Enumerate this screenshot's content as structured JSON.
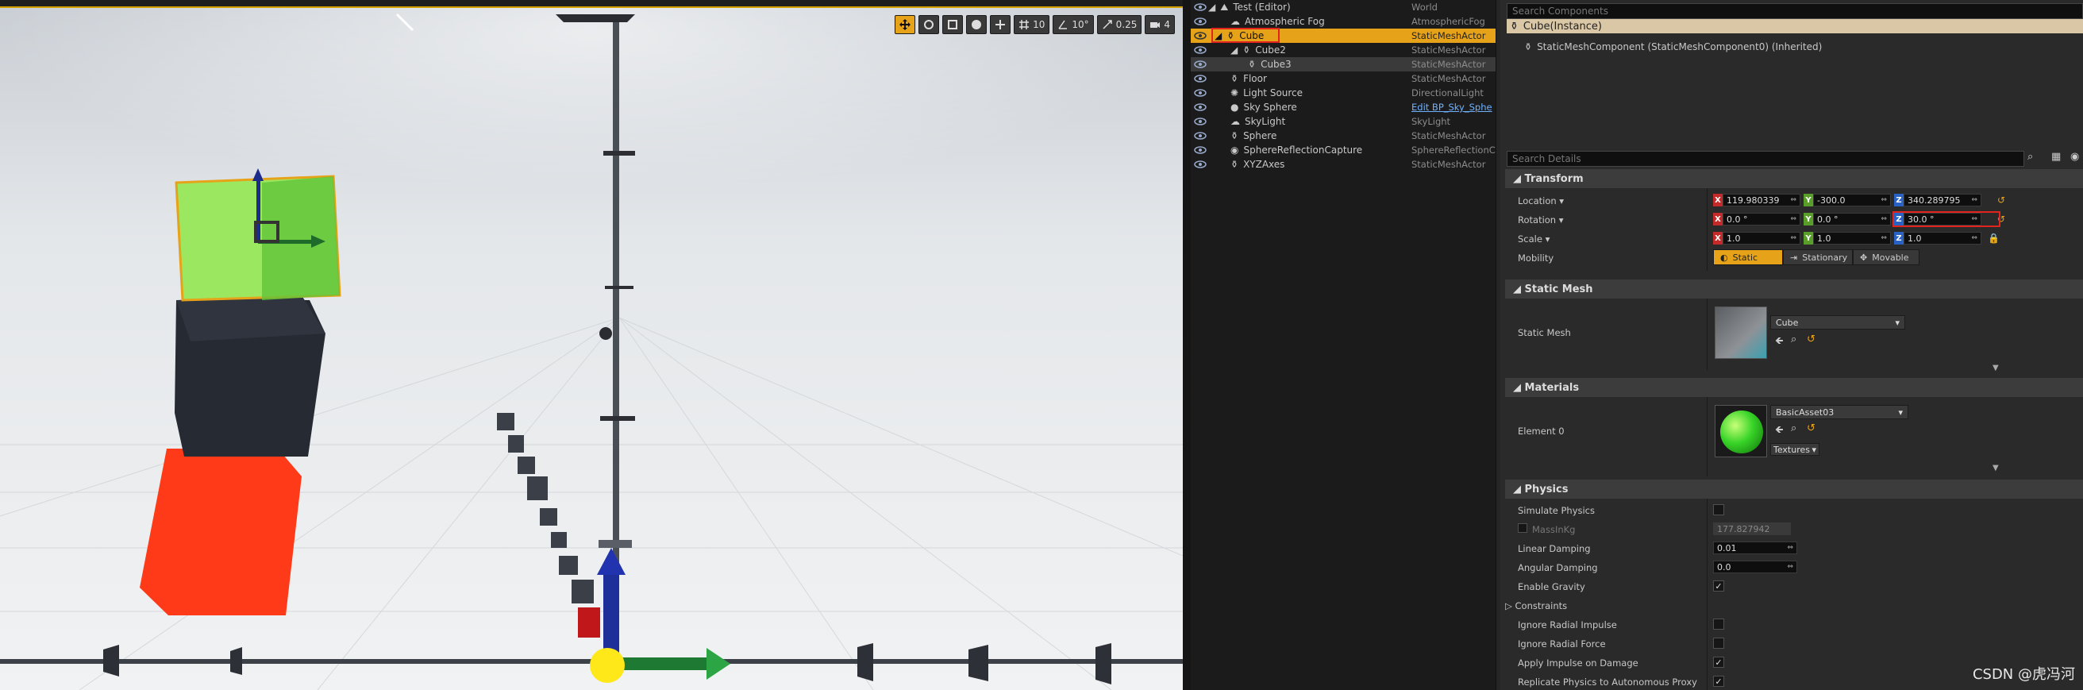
{
  "viewport": {
    "toolbar": {
      "grid_snap": "10",
      "rotation_snap": "10°",
      "scale_snap": "0.25",
      "camera_speed": "4"
    }
  },
  "outliner": {
    "rows": [
      {
        "name": "Test (Editor)",
        "type": "World"
      },
      {
        "name": "Atmospheric Fog",
        "type": "AtmosphericFog"
      },
      {
        "name": "Cube",
        "type": "StaticMeshActor"
      },
      {
        "name": "Cube2",
        "type": "StaticMeshActor"
      },
      {
        "name": "Cube3",
        "type": "StaticMeshActor"
      },
      {
        "name": "Floor",
        "type": "StaticMeshActor"
      },
      {
        "name": "Light Source",
        "type": "DirectionalLight"
      },
      {
        "name": "Sky Sphere",
        "type": "Edit BP_Sky_Sphe"
      },
      {
        "name": "SkyLight",
        "type": "SkyLight"
      },
      {
        "name": "Sphere",
        "type": "StaticMeshActor"
      },
      {
        "name": "SphereReflectionCapture",
        "type": "SphereReflectionCa"
      },
      {
        "name": "XYZAxes",
        "type": "StaticMeshActor"
      }
    ]
  },
  "details": {
    "search_components_placeholder": "Search Components",
    "component_root": "Cube(Instance)",
    "component_child": "StaticMeshComponent (StaticMeshComponent0) (Inherited)",
    "search_details_placeholder": "Search Details",
    "transform": {
      "title": "Transform",
      "location_label": "Location",
      "location": {
        "x": "119.980339",
        "y": "-300.0",
        "z": "340.289795"
      },
      "rotation_label": "Rotation",
      "rotation": {
        "x": "0.0 °",
        "y": "0.0 °",
        "z": "30.0 °"
      },
      "scale_label": "Scale",
      "scale": {
        "x": "1.0",
        "y": "1.0",
        "z": "1.0"
      },
      "mobility_label": "Mobility",
      "mobility": [
        "Static",
        "Stationary",
        "Movable"
      ],
      "axis_letters": {
        "x": "X",
        "y": "Y",
        "z": "Z"
      }
    },
    "static_mesh": {
      "title": "Static Mesh",
      "label": "Static Mesh",
      "value": "Cube"
    },
    "materials": {
      "title": "Materials",
      "label": "Element 0",
      "value": "BasicAsset03",
      "textures": "Textures"
    },
    "physics": {
      "title": "Physics",
      "simulate": "Simulate Physics",
      "mass_label": "MassInKg",
      "mass_value": "177.827942",
      "linear_label": "Linear Damping",
      "linear_value": "0.01",
      "angular_label": "Angular Damping",
      "angular_value": "0.0",
      "gravity": "Enable Gravity",
      "constraints": "Constraints",
      "radial_impulse": "Ignore Radial Impulse",
      "radial_force": "Ignore Radial Force",
      "apply_impulse": "Apply Impulse on Damage",
      "replicate": "Replicate Physics to Autonomous Proxy"
    }
  },
  "watermark": "CSDN @虎冯河",
  "colors": {
    "accent": "#e6a319",
    "highlight_box": "#e0251f",
    "x_axis": "#c42a2a",
    "y_axis": "#5a9e2a",
    "z_axis": "#2a62c4"
  }
}
